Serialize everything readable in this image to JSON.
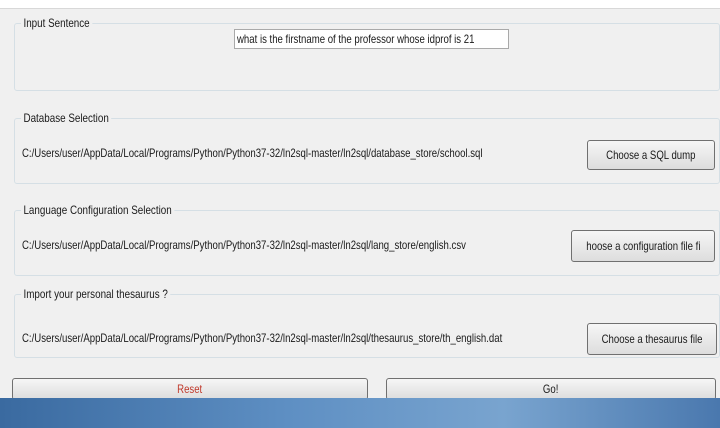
{
  "input_section": {
    "legend": "Input Sentence",
    "sentence": "what is the firstname of the professor whose idprof is 21"
  },
  "database_section": {
    "legend": "Database Selection",
    "path": "C:/Users/user/AppData/Local/Programs/Python/Python37-32/ln2sql-master/ln2sql/database_store/school.sql",
    "button_label": "Choose a SQL dump"
  },
  "language_section": {
    "legend": "Language Configuration Selection",
    "path": "C:/Users/user/AppData/Local/Programs/Python/Python37-32/ln2sql-master/ln2sql/lang_store/english.csv",
    "button_label": "hoose a configuration file fi"
  },
  "thesaurus_section": {
    "legend": "Import your personal thesaurus ?",
    "path": "C:/Users/user/AppData/Local/Programs/Python/Python37-32/ln2sql-master/ln2sql/thesaurus_store/th_english.dat",
    "button_label": "Choose a thesaurus file"
  },
  "actions": {
    "reset_label": "Reset",
    "go_label": "Go!"
  },
  "colors": {
    "window_bg": "#f0f0f0",
    "reset_text": "#c0392b",
    "taskbar": "#5e8fc3"
  }
}
